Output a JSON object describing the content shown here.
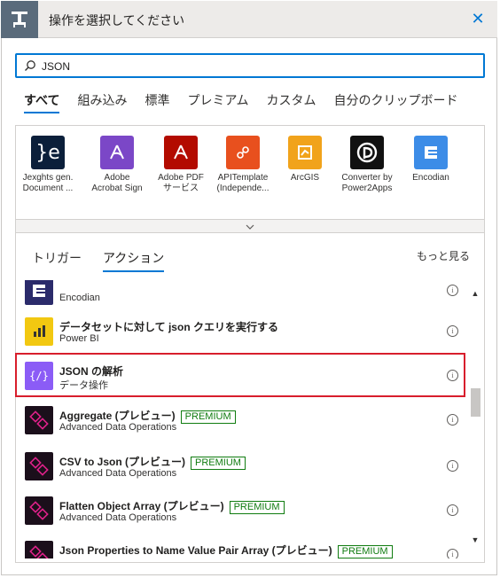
{
  "dialog": {
    "title": "操作を選択してください",
    "icon": "operation-icon",
    "close_icon": "close-icon"
  },
  "search": {
    "value": "JSON",
    "icon": "search-icon"
  },
  "tabs": [
    {
      "label": "すべて",
      "active": true
    },
    {
      "label": "組み込み"
    },
    {
      "label": "標準"
    },
    {
      "label": "プレミアム"
    },
    {
      "label": "カスタム"
    },
    {
      "label": "自分のクリップボード"
    }
  ],
  "connectors": [
    {
      "name": "Jexghts gen.\nDocument ...",
      "color": "#0b1f3a"
    },
    {
      "name": "Adobe\nAcrobat Sign",
      "color": "#7b47c7"
    },
    {
      "name": "Adobe PDF\nサービス",
      "color": "#b30b00"
    },
    {
      "name": "APITemplate\n(Independe...",
      "color": "#e8501e"
    },
    {
      "name": "ArcGIS",
      "color": "#f1a31b"
    },
    {
      "name": "Converter by\nPower2Apps",
      "color": "#111111"
    },
    {
      "name": "Encodian",
      "color": "#3c8ce7"
    }
  ],
  "subtabs": [
    {
      "label": "トリガー"
    },
    {
      "label": "アクション",
      "active": true
    }
  ],
  "more_label": "もっと見る",
  "actions": [
    {
      "title": "",
      "subtitle": "Encodian",
      "color": "#2b2b6b",
      "icon": "encodian-icon"
    },
    {
      "title": "データセットに対して json クエリを実行する",
      "subtitle": "Power BI",
      "color": "#f2c811",
      "icon": "power-bi-icon"
    },
    {
      "title": "JSON の解析",
      "subtitle": "データ操作",
      "color": "#8b5cf6",
      "icon": "data-operation-icon"
    },
    {
      "title": "Aggregate (プレビュー)",
      "badge": "PREMIUM",
      "subtitle": "Advanced Data Operations",
      "color": "#1b0f1b",
      "icon": "advanced-data-operations-icon"
    },
    {
      "title": "CSV to Json (プレビュー)",
      "badge": "PREMIUM",
      "subtitle": "Advanced Data Operations",
      "color": "#1b0f1b",
      "icon": "advanced-data-operations-icon"
    },
    {
      "title": "Flatten Object Array (プレビュー)",
      "badge": "PREMIUM",
      "subtitle": "Advanced Data Operations",
      "color": "#1b0f1b",
      "icon": "advanced-data-operations-icon"
    },
    {
      "title": "Json Properties to Name Value Pair Array (プレビュー)",
      "badge": "PREMIUM",
      "subtitle": "",
      "color": "#1b0f1b",
      "icon": "advanced-data-operations-icon"
    }
  ]
}
